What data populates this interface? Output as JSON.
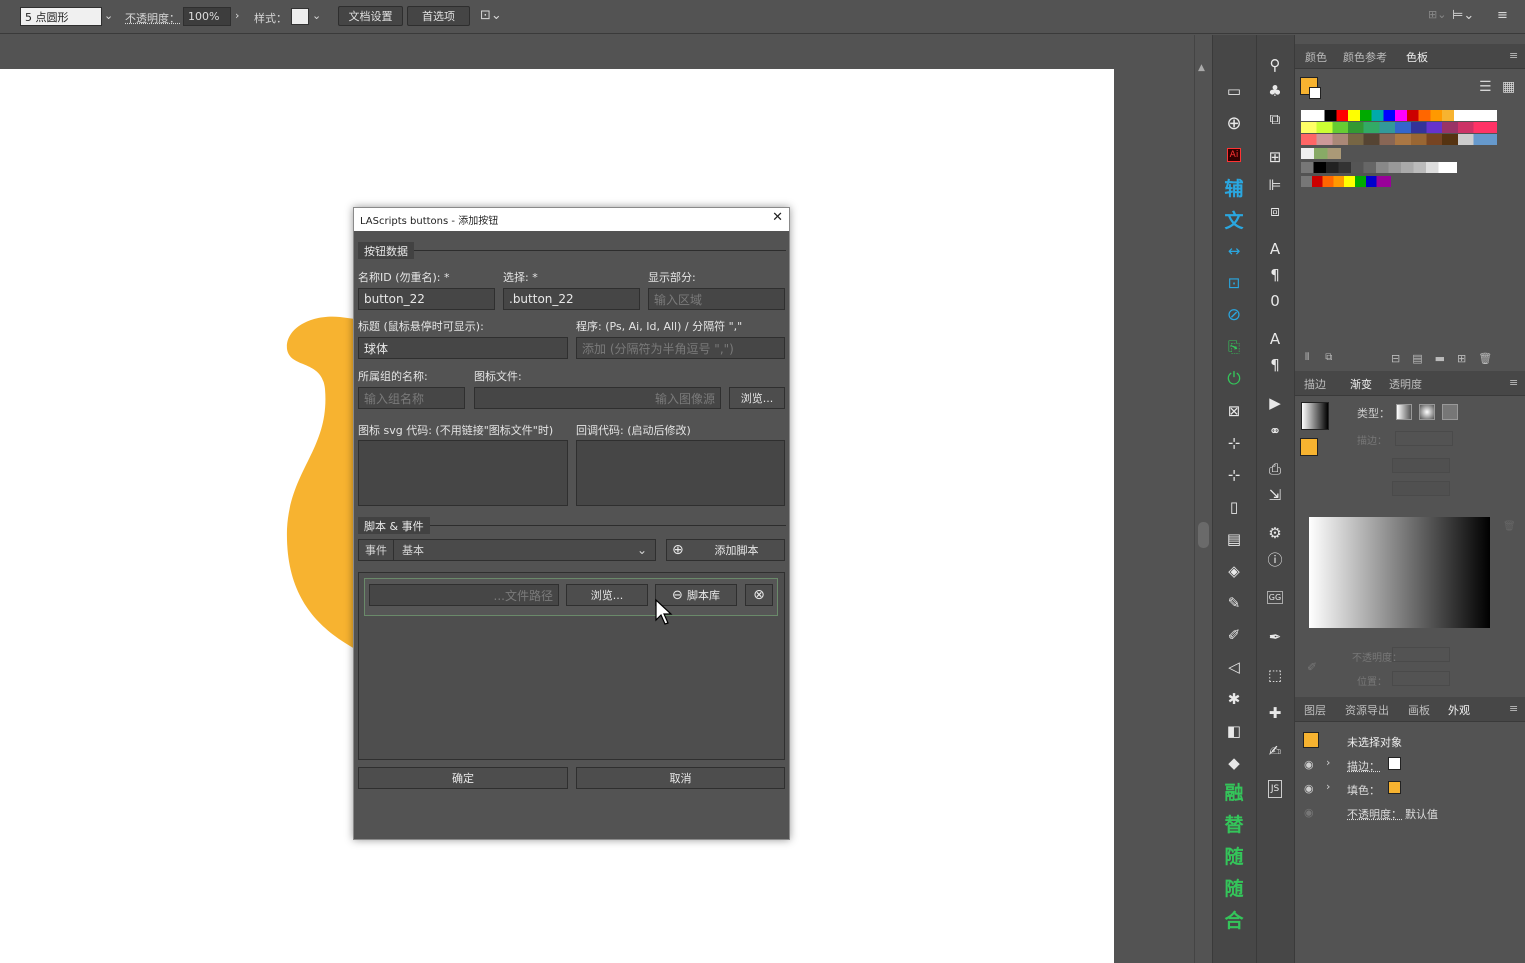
{
  "topbar": {
    "stroke_profile": "5 点圆形",
    "opacity_label": "不透明度：",
    "opacity_value": "100%",
    "style_label": "样式：",
    "doc_setup": "文档设置",
    "prefs": "首选项"
  },
  "tools_left": {
    "cn1": "辅",
    "cn2": "文",
    "cn3": "融",
    "cn4": "替",
    "cn5": "随",
    "cn6": "随",
    "cn7": "合",
    "ai": "Ai"
  },
  "tools_right": {
    "gg": "GG",
    "js": "JS"
  },
  "panel_top": {
    "tabs": [
      "颜色",
      "颜色参考",
      "色板"
    ],
    "active": "色板"
  },
  "panel_mid": {
    "tabs": [
      "描边",
      "渐变",
      "透明度"
    ],
    "type_label": "类型：",
    "stroke_label": "描边：",
    "opacity_label": "不透明度：",
    "position_label": "位置："
  },
  "panel_bot": {
    "tabs": [
      "图层",
      "资源导出",
      "画板",
      "外观"
    ],
    "no_selection": "未选择对象",
    "stroke_row": "描边：",
    "fill_row": "填色：",
    "opacity_row": "不透明度：",
    "opacity_val": "默认值"
  },
  "dialog": {
    "title": "LAScripts buttons - 添加按钮",
    "section1": "按钮数据",
    "name_id_label": "名称ID (勿重名): *",
    "name_id_value": "button_22",
    "select_label": "选择: *",
    "select_value": ".button_22",
    "display_label": "显示部分:",
    "display_placeholder": "输入区域",
    "tooltip_label": "标题 (鼠标悬停时可显示):",
    "tooltip_value": "球体",
    "program_label": "程序: (Ps, Ai, Id, All) / 分隔符 \",\"",
    "program_placeholder": "添加 (分隔符为半角逗号 \",\")",
    "group_label": "所属组的名称:",
    "group_placeholder": "输入组名称",
    "icon_file_label": "图标文件:",
    "icon_file_placeholder": "输入图像源",
    "browse": "浏览...",
    "svg_label": "图标 svg 代码: (不用链接\"图标文件\"时)",
    "callback_label": "回调代码: (启动后修改)",
    "section2": "脚本 & 事件",
    "event_label": "事件",
    "event_value": "基本",
    "add_script": "添加脚本",
    "file_path_placeholder": "...文件路径",
    "browse2": "浏览...",
    "script_lib": "脚本库",
    "ok": "确定",
    "cancel": "取消"
  },
  "colors": {
    "accent_orange": "#f7b330",
    "tool_blue": "#2aa7e0",
    "tool_green": "#34c55a"
  }
}
